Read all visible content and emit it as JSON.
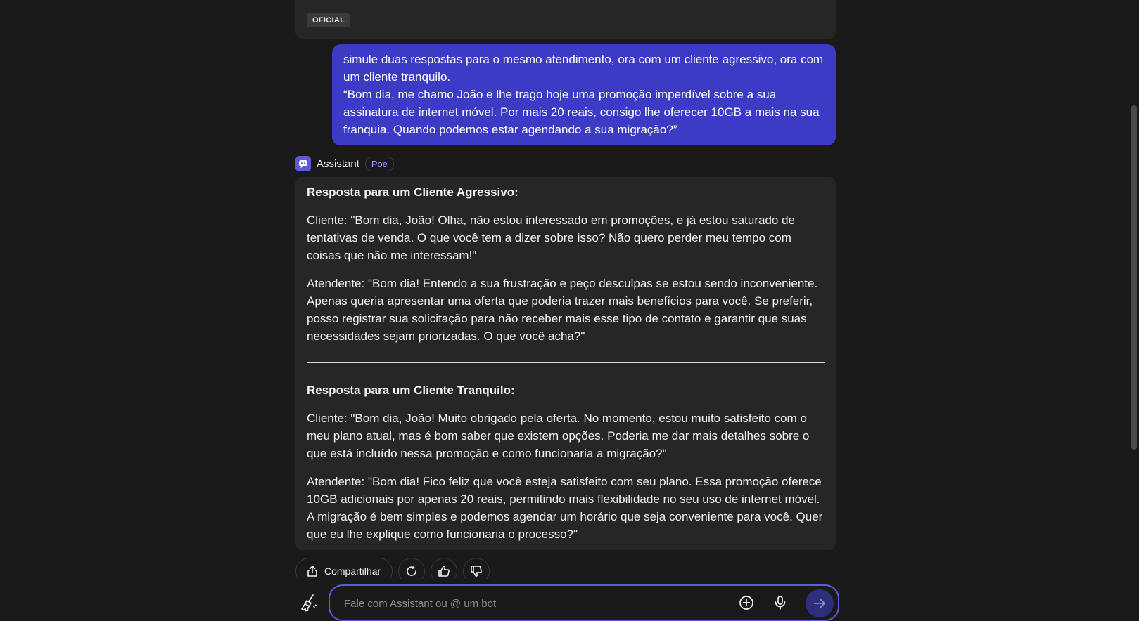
{
  "previous_message": {
    "cut_text": "",
    "badge": "OFICIAL"
  },
  "user_message": {
    "text": "simule duas respostas para o mesmo atendimento, ora com um cliente agressivo, ora com um cliente tranquilo.\n“Bom dia, me chamo João e lhe trago hoje uma promoção imperdível sobre a sua assinatura de internet móvel. Por mais 20 reais, consigo lhe oferecer 10GB a mais na sua franquia. Quando podemos estar agendando a sua migração?”"
  },
  "bot": {
    "name": "Assistant",
    "tag": "Poe"
  },
  "response": {
    "aggressive_heading": "Resposta para um Cliente Agressivo:",
    "aggressive_client": "Cliente: \"Bom dia, João! Olha, não estou interessado em promoções, e já estou saturado de tentativas de venda. O que você tem a dizer sobre isso? Não quero perder meu tempo com coisas que não me interessam!\"",
    "aggressive_agent": "Atendente: \"Bom dia! Entendo a sua frustração e peço desculpas se estou sendo inconveniente. Apenas queria apresentar uma oferta que poderia trazer mais benefícios para você. Se preferir, posso registrar sua solicitação para não receber mais esse tipo de contato e garantir que suas necessidades sejam priorizadas. O que você acha?\"",
    "calm_heading": "Resposta para um Cliente Tranquilo:",
    "calm_client": "Cliente: \"Bom dia, João! Muito obrigado pela oferta. No momento, estou muito satisfeito com o meu plano atual, mas é bom saber que existem opções. Poderia me dar mais detalhes sobre o que está incluído nessa promoção e como funcionaria a migração?\"",
    "calm_agent": "Atendente: \"Bom dia! Fico feliz que você esteja satisfeito com seu plano. Essa promoção oferece 10GB adicionais por apenas 20 reais, permitindo mais flexibilidade no seu uso de internet móvel. A migração é bem simples e podemos agendar um horário que seja conveniente para você. Quer que eu lhe explique como funcionaria o processo?\""
  },
  "actions": {
    "share_label": "Compartilhar"
  },
  "composer": {
    "placeholder": "Fale com Assistant ou @ um bot"
  },
  "colors": {
    "background": "#1a1a1a",
    "card": "#262626",
    "user_bubble": "#3b3bc6",
    "accent": "#5b5be0"
  }
}
